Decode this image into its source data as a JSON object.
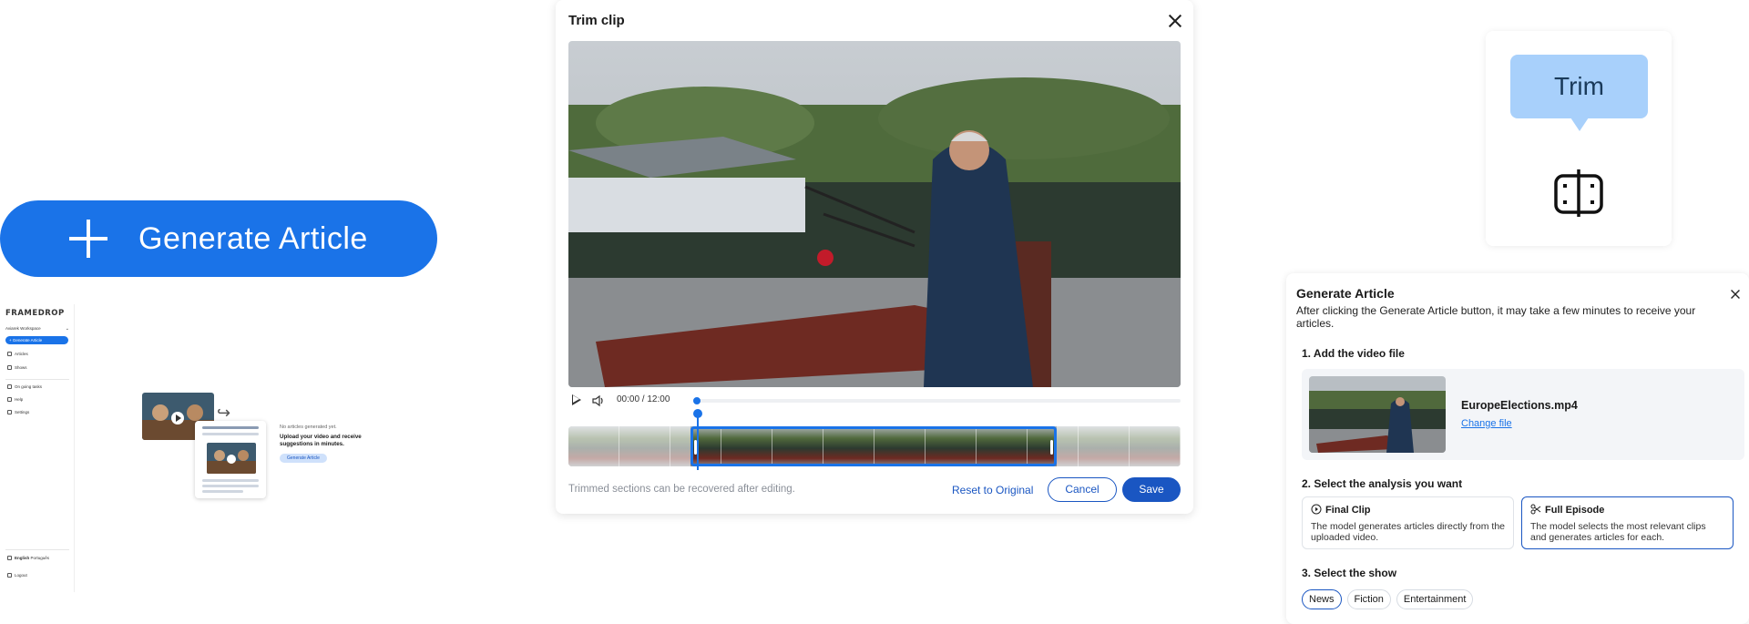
{
  "big_button": {
    "label": "Generate Article"
  },
  "mini_app": {
    "logo": "FRAMEDROP",
    "workspace": "Aviarek Workspace",
    "generate_label": "Generate Article",
    "nav": [
      "Articles",
      "Shows",
      "On going tasks",
      "Help",
      "Settings"
    ],
    "language": "English",
    "language_alt": "Português",
    "logout": "Logout",
    "empty_title": "No articles generated yet.",
    "empty_subtitle": "Upload your video and receive suggestions in minutes.",
    "empty_button": "Generate Article"
  },
  "trim_modal": {
    "title": "Trim clip",
    "current_time": "00:00",
    "total_time": "12:00",
    "hint": "Trimmed sections can be recovered after editing.",
    "reset_label": "Reset to Original",
    "cancel_label": "Cancel",
    "save_label": "Save"
  },
  "tooltip": {
    "label": "Trim"
  },
  "generate_panel": {
    "title": "Generate Article",
    "description": "After clicking the Generate Article button, it may take a few minutes to receive your articles.",
    "step1": "1. Add the video file",
    "file_name": "EuropeElections.mp4",
    "change_file": "Change file",
    "step2": "2. Select the analysis you want",
    "options": [
      {
        "title": "Final Clip",
        "desc": "The model generates articles directly from the uploaded video.",
        "selected": false
      },
      {
        "title": "Full Episode",
        "desc": "The model selects the most relevant clips and generates articles for each.",
        "selected": true
      }
    ],
    "step3": "3. Select the show",
    "shows": [
      {
        "label": "News",
        "selected": true
      },
      {
        "label": "Fiction",
        "selected": false
      },
      {
        "label": "Entertainment",
        "selected": false
      }
    ]
  },
  "colors": {
    "primary": "#1a73e8",
    "primary_dark": "#1a56c2",
    "tooltip_bg": "#a8d0fb"
  }
}
